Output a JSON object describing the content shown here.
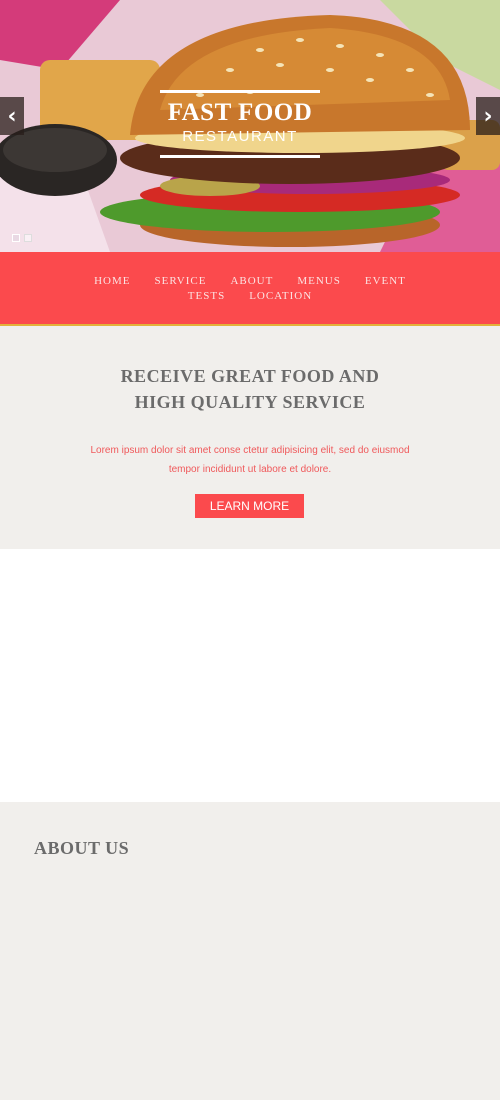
{
  "slider": {
    "prev_glyph": "‹",
    "next_glyph": "›",
    "logo_line1": "FAST FOOD",
    "logo_line2": "RESTAURANT",
    "pager_count": 2
  },
  "nav": {
    "items": [
      "HOME",
      "SERVICE",
      "ABOUT",
      "MENUS",
      "EVENT",
      "TESTS",
      "LOCATION"
    ]
  },
  "intro": {
    "heading": "RECEIVE GREAT FOOD AND HIGH QUALITY SERVICE",
    "text": "Lorem ipsum dolor sit amet conse ctetur adipisicing elit, sed do eiusmod tempor incididunt ut labore et dolore.",
    "button_label": "LEARN MORE"
  },
  "about": {
    "heading": "ABOUT US"
  },
  "colors": {
    "accent": "#fb4a4d",
    "background": "#f1efec",
    "heading_gray": "#6b6b6b"
  }
}
